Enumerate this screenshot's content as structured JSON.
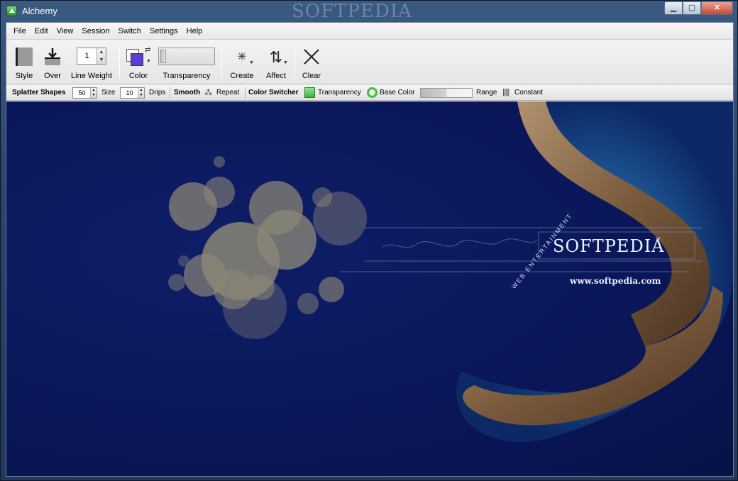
{
  "window": {
    "title": "Alchemy",
    "title_watermark": "SOFTPEDIA",
    "controls": {
      "minimize": "▁",
      "maximize": "▢",
      "close": "✕"
    }
  },
  "menu": {
    "items": [
      "File",
      "Edit",
      "View",
      "Session",
      "Switch",
      "Settings",
      "Help"
    ]
  },
  "toolbar": {
    "style_label": "Style",
    "over_label": "Over",
    "line_weight_label": "Line Weight",
    "line_weight_value": "1",
    "color_label": "Color",
    "transparency_label": "Transparency",
    "create_label": "Create",
    "affect_label": "Affect",
    "clear_label": "Clear"
  },
  "subbar": {
    "splatter_shapes": "Splatter Shapes",
    "size_value": "50",
    "size_label": "Size",
    "drips_value": "10",
    "drips_label": "Drips",
    "smooth": "Smooth",
    "repeat": "Repeat",
    "color_switcher": "Color Switcher",
    "transparency": "Transparency",
    "base_color": "Base Color",
    "range": "Range",
    "constant": "Constant"
  },
  "canvas": {
    "logo_text": "SOFTPEDIA",
    "trademark": "™",
    "url_text": "www.softpedia.com",
    "curve_text": "WEB ENTERTAINMENT"
  },
  "colors": {
    "canvas_bg": "#0a1658",
    "splatter": "#8a8676",
    "accent_green": "#3fb53a",
    "color_swatch": "#5a3fd6"
  }
}
